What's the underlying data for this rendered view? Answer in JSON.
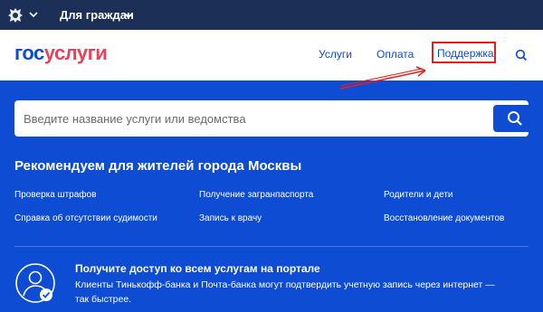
{
  "topbar": {
    "for_citizens": "Для граждан"
  },
  "header": {
    "logo_part1": "гос",
    "logo_part2": "услуги",
    "nav": {
      "uslugi": "Услуги",
      "oplata": "Оплата",
      "support": "Поддержка"
    }
  },
  "search": {
    "placeholder": "Введите название услуги или ведомства"
  },
  "recommend": {
    "title": "Рекомендуем для жителей города Москвы",
    "links": [
      "Проверка штрафов",
      "Получение загранпаспорта",
      "Родители и дети",
      "Справка об отсутствии судимости",
      "Запись к врачу",
      "Восстановление документов"
    ]
  },
  "promo": {
    "title": "Получите доступ ко всем услугам на портале",
    "text": "Клиенты Тинькофф-банка и Почта-банка могут подтвердить учетную запись через интернет — так быстрее."
  },
  "colors": {
    "brand_blue": "#0d4cd3",
    "brand_red": "#ee3f58",
    "topbar": "#1b2f57",
    "highlight": "#e0211d"
  },
  "icons": {
    "emblem": "coat-of-arms-icon",
    "search": "search-icon",
    "avatar": "user-check-icon"
  }
}
